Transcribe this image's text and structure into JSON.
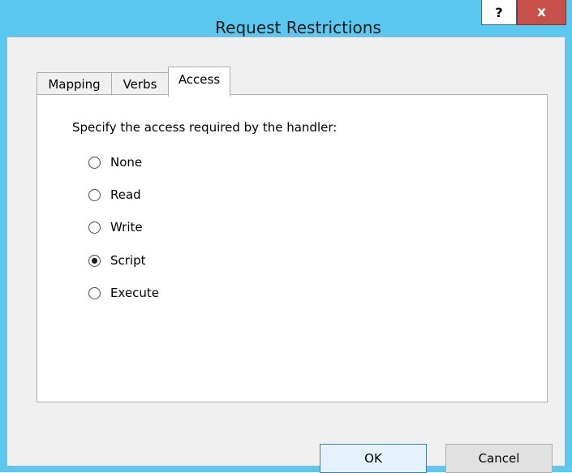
{
  "window": {
    "title": "Request Restrictions",
    "help_label": "?",
    "close_label": "x"
  },
  "tabs": [
    {
      "label": "Mapping",
      "active": false
    },
    {
      "label": "Verbs",
      "active": false
    },
    {
      "label": "Access",
      "active": true
    }
  ],
  "access": {
    "instruction": "Specify the access required by the handler:",
    "options": [
      {
        "label": "None",
        "selected": false
      },
      {
        "label": "Read",
        "selected": false
      },
      {
        "label": "Write",
        "selected": false
      },
      {
        "label": "Script",
        "selected": true
      },
      {
        "label": "Execute",
        "selected": false
      }
    ]
  },
  "buttons": {
    "ok_label": "OK",
    "cancel_label": "Cancel"
  },
  "colors": {
    "titlebar": "#5bc8f0",
    "close": "#c7504a"
  }
}
